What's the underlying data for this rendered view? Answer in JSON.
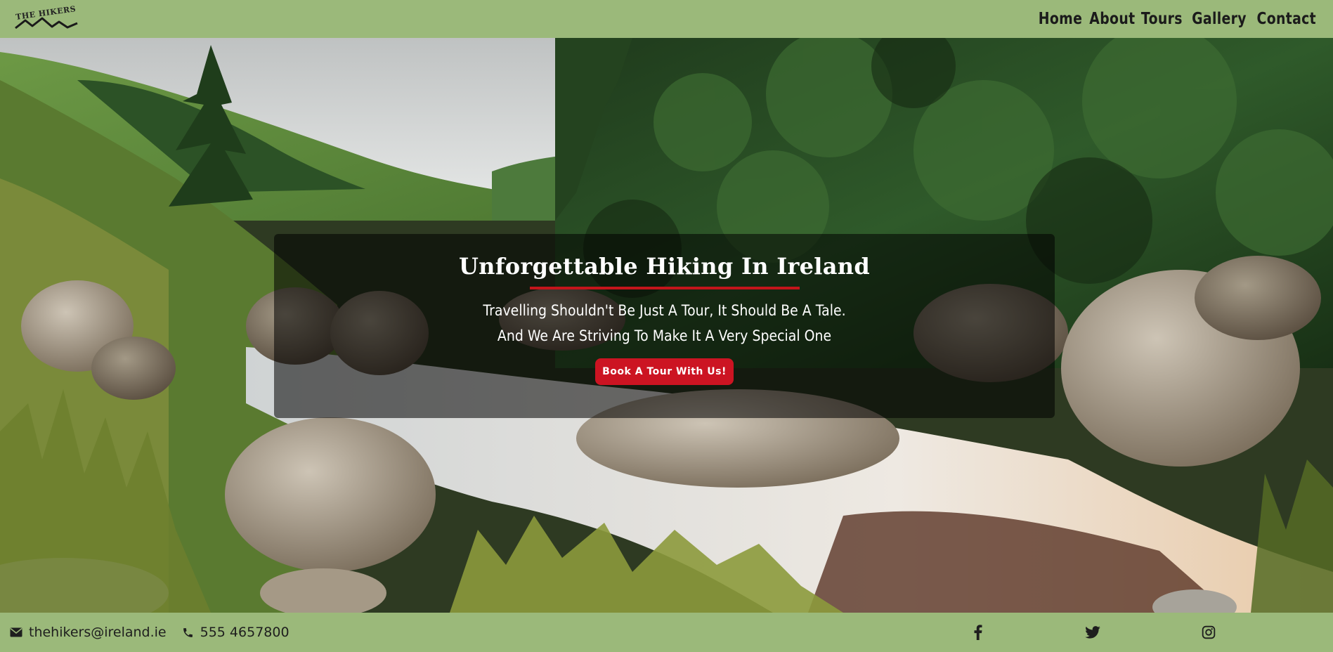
{
  "header": {
    "logo_text": "THE HIKERS",
    "nav": [
      "Home",
      "About",
      "Tours",
      "Gallery",
      "Contact"
    ]
  },
  "hero": {
    "title": "Unforgettable Hiking In Ireland",
    "tagline_line1": "Travelling Shouldn't Be Just A Tour, It Should Be A Tale.",
    "tagline_line2": "And We Are Striving To Make It A Very Special One",
    "cta_label": "Book A Tour With Us!"
  },
  "footer": {
    "email": "thehikers@ireland.ie",
    "phone": "555 4657800",
    "icons": [
      "envelope-icon",
      "phone-icon",
      "facebook-icon",
      "twitter-icon",
      "instagram-icon"
    ]
  },
  "colors": {
    "header_bg": "#9bb97a",
    "accent_red": "#c3151b",
    "button_red": "#cc1422"
  }
}
